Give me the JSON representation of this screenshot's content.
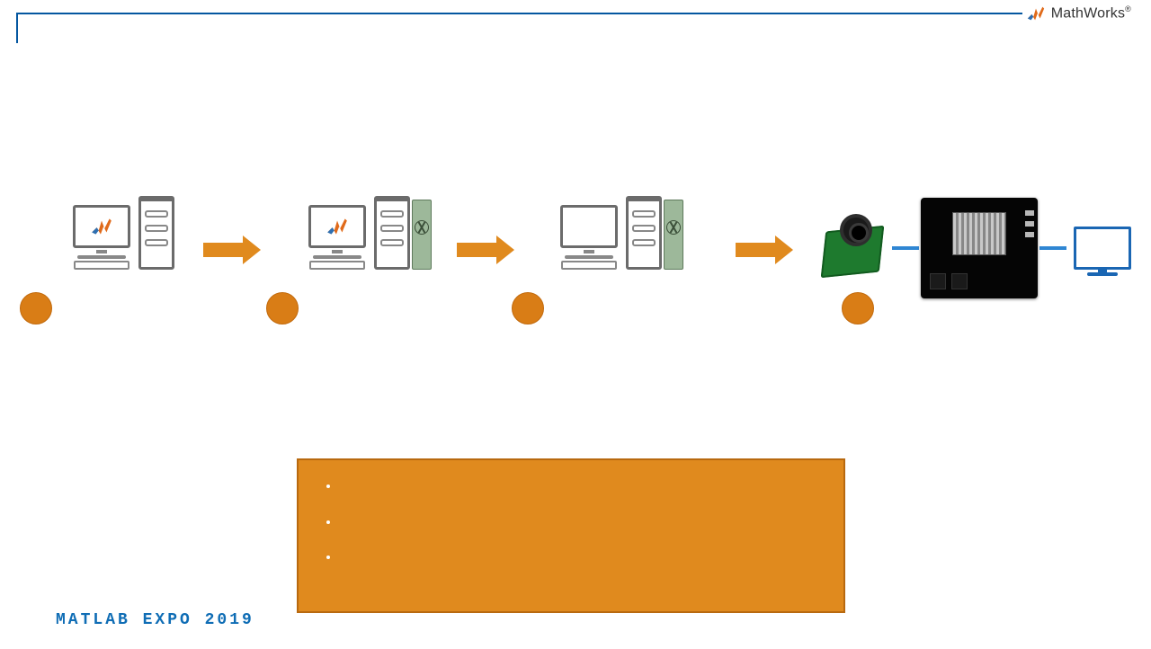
{
  "brand": {
    "name": "MathWorks"
  },
  "footer": {
    "text": "MATLAB EXPO 2019"
  },
  "stages": {
    "s1": {
      "label": ""
    },
    "s2": {
      "label": ""
    },
    "s3": {
      "label": ""
    },
    "s4": {
      "label": ""
    }
  },
  "callout": {
    "items": [
      "",
      "",
      ""
    ]
  }
}
